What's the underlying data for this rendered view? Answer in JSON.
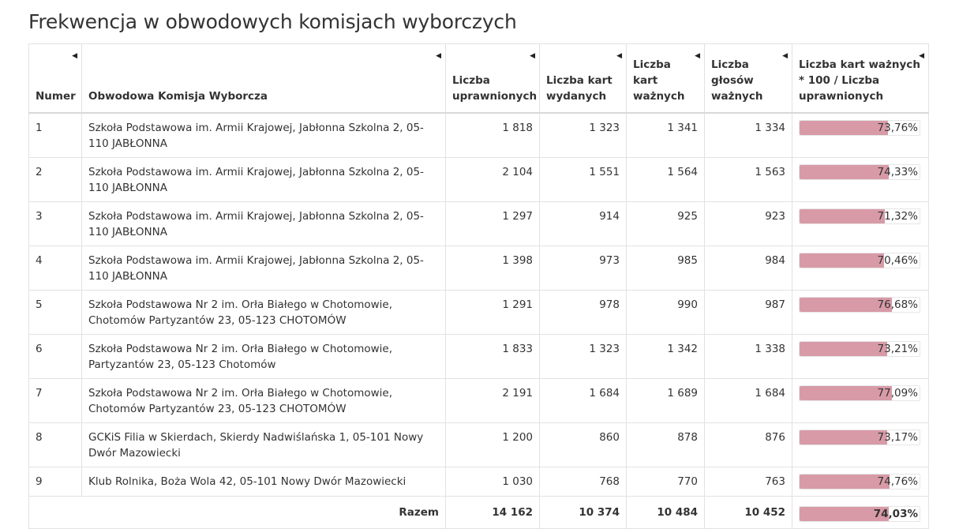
{
  "title": "Frekwencja w obwodowych komisjach wyborczych",
  "columns": [
    "Numer",
    "Obwodowa Komisja Wyborcza",
    "Liczba uprawnionych",
    "Liczba kart wydanych",
    "Liczba kart ważnych",
    "Liczba głosów ważnych",
    "Liczba kart ważnych * 100 / Liczba uprawnionych"
  ],
  "sort_icon": "triangle-left-icon",
  "bar_color": "#d89aa7",
  "rows": [
    {
      "num": "1",
      "name": "Szkoła Podstawowa im. Armii Krajowej, Jabłonna Szkolna 2, 05-110 JABŁONNA",
      "uprawnionych": "1 818",
      "wydanych": "1 323",
      "kart_waznych": "1 341",
      "glosow_waznych": "1 334",
      "pct": "73,76%",
      "pct_value": 73.76
    },
    {
      "num": "2",
      "name": "Szkoła Podstawowa im. Armii Krajowej, Jabłonna Szkolna 2, 05-110 JABŁONNA",
      "uprawnionych": "2 104",
      "wydanych": "1 551",
      "kart_waznych": "1 564",
      "glosow_waznych": "1 563",
      "pct": "74,33%",
      "pct_value": 74.33
    },
    {
      "num": "3",
      "name": "Szkoła Podstawowa im. Armii Krajowej, Jabłonna Szkolna 2, 05-110 JABŁONNA",
      "uprawnionych": "1 297",
      "wydanych": "914",
      "kart_waznych": "925",
      "glosow_waznych": "923",
      "pct": "71,32%",
      "pct_value": 71.32
    },
    {
      "num": "4",
      "name": "Szkoła Podstawowa im. Armii Krajowej, Jabłonna Szkolna 2, 05-110 JABŁONNA",
      "uprawnionych": "1 398",
      "wydanych": "973",
      "kart_waznych": "985",
      "glosow_waznych": "984",
      "pct": "70,46%",
      "pct_value": 70.46
    },
    {
      "num": "5",
      "name": "Szkoła Podstawowa Nr 2 im. Orła Białego w Chotomowie, Chotomów Partyzantów 23, 05-123 CHOTOMÓW",
      "uprawnionych": "1 291",
      "wydanych": "978",
      "kart_waznych": "990",
      "glosow_waznych": "987",
      "pct": "76,68%",
      "pct_value": 76.68
    },
    {
      "num": "6",
      "name": "Szkoła Podstawowa Nr 2 im. Orła Białego w Chotomowie, Partyzantów 23, 05-123 Chotomów",
      "uprawnionych": "1 833",
      "wydanych": "1 323",
      "kart_waznych": "1 342",
      "glosow_waznych": "1 338",
      "pct": "73,21%",
      "pct_value": 73.21
    },
    {
      "num": "7",
      "name": "Szkoła Podstawowa Nr 2 im. Orła Białego w Chotomowie, Chotomów Partyzantów 23, 05-123 CHOTOMÓW",
      "uprawnionych": "2 191",
      "wydanych": "1 684",
      "kart_waznych": "1 689",
      "glosow_waznych": "1 684",
      "pct": "77,09%",
      "pct_value": 77.09
    },
    {
      "num": "8",
      "name": "GCKiS Filia w Skierdach, Skierdy Nadwiślańska 1, 05-101 Nowy Dwór Mazowiecki",
      "uprawnionych": "1 200",
      "wydanych": "860",
      "kart_waznych": "878",
      "glosow_waznych": "876",
      "pct": "73,17%",
      "pct_value": 73.17
    },
    {
      "num": "9",
      "name": "Klub Rolnika, Boża Wola 42, 05-101 Nowy Dwór Mazowiecki",
      "uprawnionych": "1 030",
      "wydanych": "768",
      "kart_waznych": "770",
      "glosow_waznych": "763",
      "pct": "74,76%",
      "pct_value": 74.76
    }
  ],
  "total": {
    "label": "Razem",
    "uprawnionych": "14 162",
    "wydanych": "10 374",
    "kart_waznych": "10 484",
    "glosow_waznych": "10 452",
    "pct": "74,03%",
    "pct_value": 74.03
  }
}
